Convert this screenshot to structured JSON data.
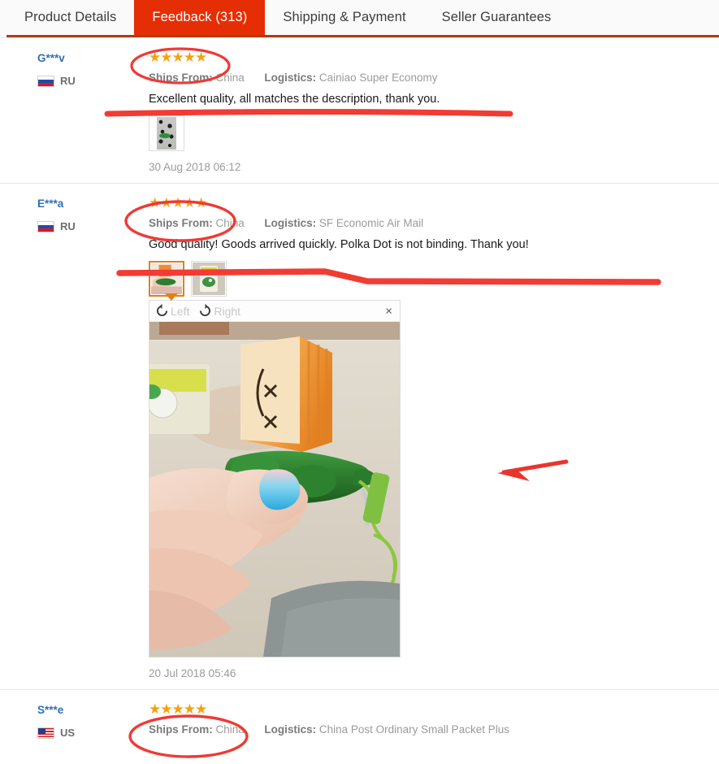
{
  "tabs": [
    {
      "label": "Product Details",
      "active": false
    },
    {
      "label": "Feedback (313)",
      "active": true
    },
    {
      "label": "Shipping & Payment",
      "active": false
    },
    {
      "label": "Seller Guarantees",
      "active": false
    }
  ],
  "colors": {
    "tab_active_bg": "#e62e04",
    "tab_underline": "#b33a12",
    "star": "#f7a10a",
    "username": "#2f6fb5",
    "annotation": "#ef3a35",
    "thumb_selected_border": "#e0801a"
  },
  "labels": {
    "ships_from": "Ships From:",
    "logistics": "Logistics:",
    "rotate_left": "Left",
    "rotate_right": "Right",
    "close": "×",
    "star_glyph": "★★★★★"
  },
  "reviews": [
    {
      "user": "G***v",
      "country_code": "RU",
      "flag": "flag-ru",
      "rating": 5,
      "ships_from": "China",
      "logistics": "Cainiao Super Economy",
      "text": "Excellent quality, all matches the description, thank you.",
      "date": "30 Aug 2018 06:12",
      "thumbnails": [
        "dotted-fabric-thumbnail"
      ],
      "viewer_open": false
    },
    {
      "user": "E***a",
      "country_code": "RU",
      "flag": "flag-ru",
      "rating": 5,
      "ships_from": "China",
      "logistics": "SF Economic Air Mail",
      "text": "Good quality! Goods arrived quickly. Polka Dot is not binding. Thank you!",
      "date": "20 Jul 2018 05:46",
      "thumbnails": [
        "hand-holding-pea-pod-squishy",
        "packaged-pea-pod-squishy"
      ],
      "viewer_open": true,
      "viewer_selected_index": 0
    },
    {
      "user": "S***e",
      "country_code": "US",
      "flag": "flag-us",
      "rating": 5,
      "ships_from": "China",
      "logistics": "China Post Ordinary Small Packet Plus",
      "text": "",
      "date": "",
      "thumbnails": [],
      "viewer_open": false
    }
  ],
  "annotations": [
    {
      "type": "ellipse",
      "name": "circle-stars-review-1"
    },
    {
      "type": "underline",
      "name": "underline-review-1-text"
    },
    {
      "type": "ellipse",
      "name": "circle-stars-review-2"
    },
    {
      "type": "underline",
      "name": "underline-review-2-text"
    },
    {
      "type": "arrow",
      "name": "red-arrow-pointing-left"
    },
    {
      "type": "ellipse",
      "name": "circle-stars-review-3"
    }
  ]
}
